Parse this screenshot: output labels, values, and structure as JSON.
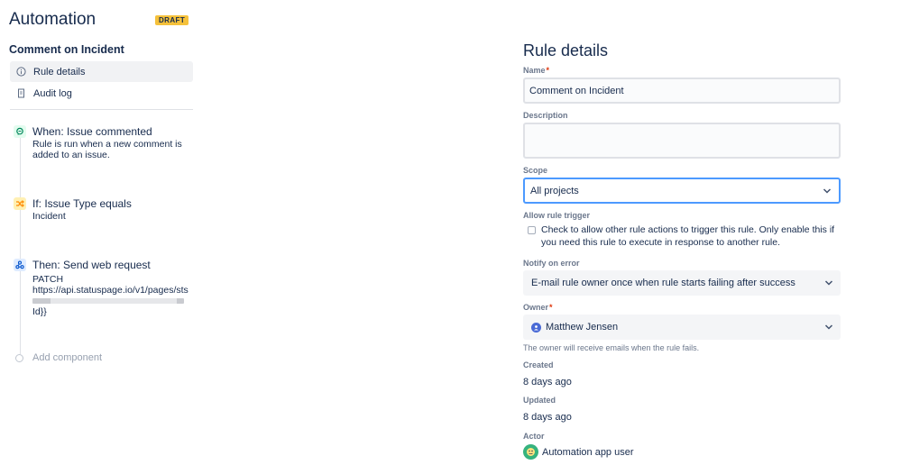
{
  "app": {
    "title": "Automation",
    "badge": "DRAFT"
  },
  "rule": {
    "name": "Comment on Incident"
  },
  "nav": {
    "items": [
      {
        "label": "Rule details",
        "icon": "info-icon",
        "active": true
      },
      {
        "label": "Audit log",
        "icon": "document-icon",
        "active": false
      }
    ]
  },
  "flow": {
    "trigger": {
      "title": "When: Issue commented",
      "desc": "Rule is run when a new comment is added to an issue.",
      "icon": "comment-icon",
      "color": "#e3fcef"
    },
    "condition": {
      "title": "If: Issue Type equals",
      "desc": "Incident",
      "icon": "shuffle-icon",
      "color": "#fff0b3"
    },
    "action": {
      "title": "Then: Send web request",
      "desc_line1": "PATCH",
      "desc_line2": "https://api.statuspage.io/v1/pages/sts",
      "desc_tail": "Id}}",
      "icon": "webhook-icon",
      "color": "#deebff"
    },
    "add_label": "Add component"
  },
  "details": {
    "title": "Rule details",
    "name_label": "Name",
    "name_value": "Comment on Incident",
    "description_label": "Description",
    "description_value": "",
    "scope_label": "Scope",
    "scope_value": "All projects",
    "trigger_label": "Allow rule trigger",
    "trigger_text": "Check to allow other rule actions to trigger this rule. Only enable this if you need this rule to execute in response to another rule.",
    "notify_label": "Notify on error",
    "notify_value": "E-mail rule owner once when rule starts failing after success",
    "owner_label": "Owner",
    "owner_value": "Matthew Jensen",
    "owner_helper": "The owner will receive emails when the rule fails.",
    "created_label": "Created",
    "created_value": "8 days ago",
    "updated_label": "Updated",
    "updated_value": "8 days ago",
    "actor_label": "Actor",
    "actor_value": "Automation app user"
  },
  "colors": {
    "accent": "#4c9aff",
    "draft": "#f5c13b",
    "required": "#de350b"
  }
}
